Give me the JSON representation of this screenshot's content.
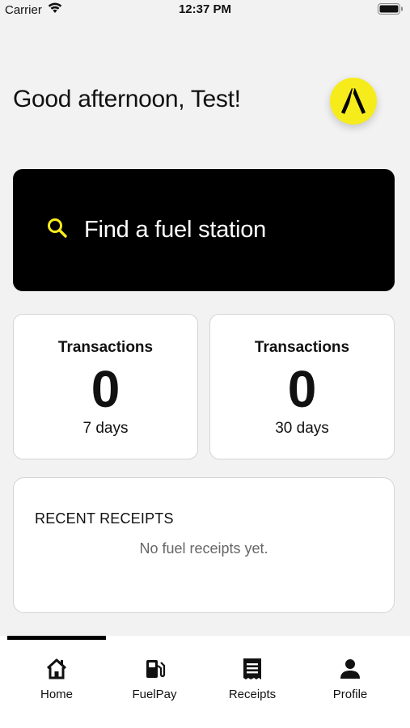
{
  "status_bar": {
    "carrier": "Carrier",
    "time": "12:37 PM"
  },
  "header": {
    "greeting": "Good afternoon, Test!",
    "logo_color": "#f7ec1b"
  },
  "search": {
    "label": "Find a fuel station",
    "icon": "search-icon",
    "accent_color": "#f7ec1b"
  },
  "stats": [
    {
      "title": "Transactions",
      "value": "0",
      "period": "7 days"
    },
    {
      "title": "Transactions",
      "value": "0",
      "period": "30 days"
    }
  ],
  "receipts": {
    "heading": "RECENT RECEIPTS",
    "empty_message": "No fuel receipts yet."
  },
  "tab_bar": {
    "active_index": 0,
    "items": [
      {
        "label": "Home",
        "icon": "home-icon"
      },
      {
        "label": "FuelPay",
        "icon": "fuel-pump-icon"
      },
      {
        "label": "Receipts",
        "icon": "receipt-icon"
      },
      {
        "label": "Profile",
        "icon": "person-icon"
      }
    ]
  }
}
